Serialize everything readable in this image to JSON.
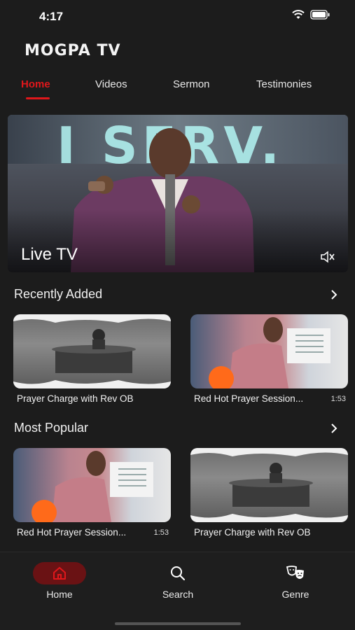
{
  "status": {
    "time": "4:17"
  },
  "app": {
    "title": "MOGPA TV"
  },
  "tabs": [
    {
      "label": "Home",
      "active": true
    },
    {
      "label": "Videos",
      "active": false
    },
    {
      "label": "Sermon",
      "active": false
    },
    {
      "label": "Testimonies",
      "active": false
    }
  ],
  "hero": {
    "banner_text": "I SERV.",
    "label": "Live TV",
    "mute_icon": "speaker-mute-icon"
  },
  "recently_added": {
    "title": "Recently Added",
    "items": [
      {
        "title": "Prayer Charge with Rev OB",
        "duration": "",
        "thumb": "hall"
      },
      {
        "title": "Red Hot Prayer Session...",
        "duration": "1:53",
        "thumb": "preach"
      }
    ]
  },
  "most_popular": {
    "title": "Most Popular",
    "items": [
      {
        "title": "Red Hot Prayer Session...",
        "duration": "1:53",
        "thumb": "preach"
      },
      {
        "title": "Prayer Charge with Rev OB",
        "duration": "",
        "thumb": "hall"
      }
    ]
  },
  "bottom_nav": [
    {
      "label": "Home",
      "icon": "home-icon",
      "active": true
    },
    {
      "label": "Search",
      "icon": "search-icon",
      "active": false
    },
    {
      "label": "Genre",
      "icon": "theater-masks-icon",
      "active": false
    }
  ],
  "colors": {
    "accent": "#e0171b",
    "background": "#1c1c1c",
    "nav_pill": "#6a1214"
  }
}
